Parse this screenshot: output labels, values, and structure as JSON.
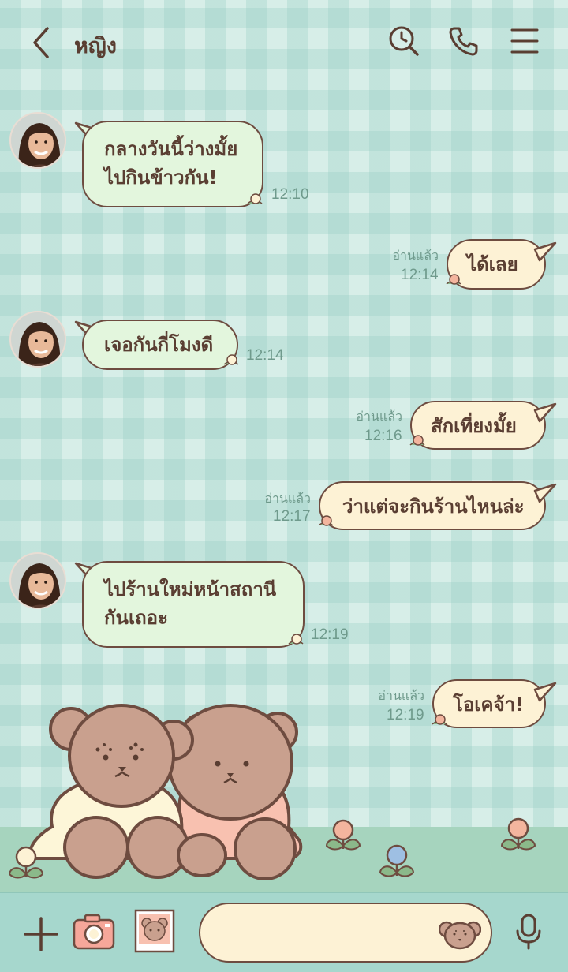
{
  "header": {
    "title": "หญิง",
    "icons": [
      "back-chevron-icon",
      "search-icon",
      "phone-icon",
      "menu-icon"
    ]
  },
  "messages": [
    {
      "side": "in",
      "lines": [
        "กลางวันนี้ว่างมั้ย",
        "ไปกินข้าวกัน!"
      ],
      "time": "12:10"
    },
    {
      "side": "out",
      "lines": [
        "ได้เลย"
      ],
      "time": "12:14",
      "read": "อ่านแล้ว"
    },
    {
      "side": "in",
      "lines": [
        "เจอกันกี่โมงดี"
      ],
      "time": "12:14"
    },
    {
      "side": "out",
      "lines": [
        "สักเที่ยงมั้ย"
      ],
      "time": "12:16",
      "read": "อ่านแล้ว"
    },
    {
      "side": "out",
      "lines": [
        "ว่าแต่จะกินร้านไหนล่ะ"
      ],
      "time": "12:17",
      "read": "อ่านแล้ว"
    },
    {
      "side": "in",
      "lines": [
        "ไปร้านใหม่หน้าสถานี",
        "กันเถอะ"
      ],
      "time": "12:19"
    },
    {
      "side": "out",
      "lines": [
        "โอเคจ้า!"
      ],
      "time": "12:19",
      "read": "อ่านแล้ว"
    }
  ],
  "bottom_bar": {
    "icons": [
      "plus-icon",
      "camera-icon",
      "bear-photo-icon",
      "bear-emoji-icon",
      "microphone-icon"
    ],
    "input_value": "",
    "input_placeholder": ""
  },
  "colors": {
    "text_brown": "#5a3e32",
    "bubble_in": "#e3f6dd",
    "bubble_out": "#fdf2d5",
    "time_green": "#6f9a8c",
    "ground": "#a6d4be",
    "bottom_bar": "#a6d7cd"
  }
}
